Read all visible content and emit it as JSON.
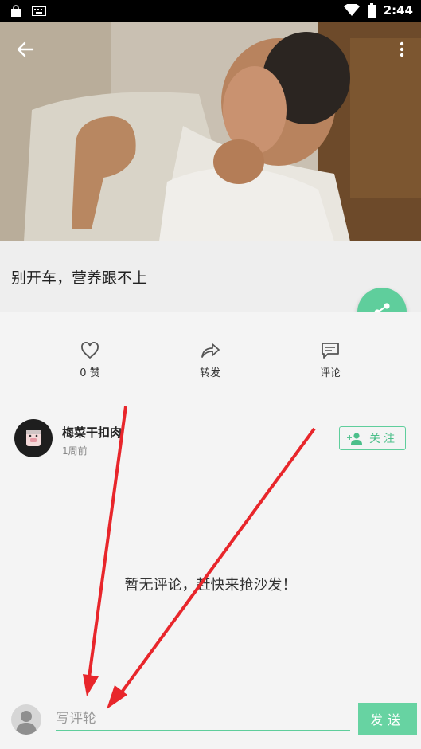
{
  "status_bar": {
    "time": "2:44"
  },
  "post": {
    "caption": "别开车，营养跟不上"
  },
  "actions": [
    {
      "id": "like",
      "label": "0 赞"
    },
    {
      "id": "repost",
      "label": "转发"
    },
    {
      "id": "comment",
      "label": "评论"
    }
  ],
  "author": {
    "name": "梅菜干扣肉",
    "time": "1周前",
    "follow_label": "关注"
  },
  "comments": {
    "empty_text": "暂无评论，赶快来抢沙发！"
  },
  "input": {
    "placeholder": "写评轮",
    "send_label": "发送"
  },
  "colors": {
    "accent": "#5fce9c",
    "annotation_arrow": "#e8262b"
  }
}
